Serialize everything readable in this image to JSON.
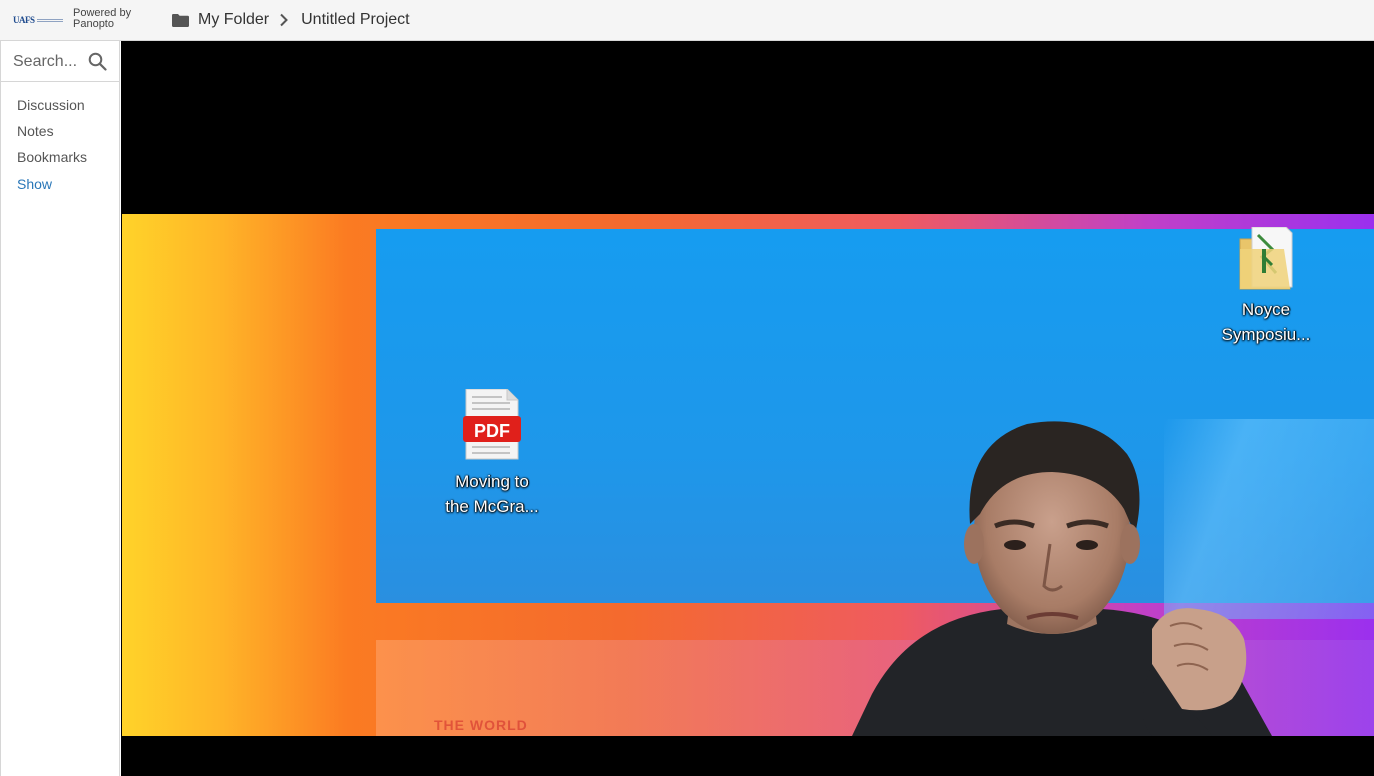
{
  "header": {
    "logo_text": "UAFS",
    "powered_line1": "Powered by",
    "powered_line2": "Panopto",
    "breadcrumb": [
      "My Folder",
      "Untitled Project"
    ]
  },
  "sidebar": {
    "search_placeholder": "Search...",
    "items": [
      "Discussion",
      "Notes",
      "Bookmarks"
    ],
    "show_label": "Show"
  },
  "video": {
    "desktop_icons": [
      {
        "type": "PDF",
        "label_line1": "Moving to",
        "label_line2": "the McGra..."
      },
      {
        "label_line1": "Noyce",
        "label_line2": "Symposiu..."
      }
    ],
    "blurred_text": "THE WORLD"
  },
  "colors": {
    "link": "#2a77b8",
    "pdf_red": "#e0201b",
    "desktop_blue": "#169cf0"
  }
}
